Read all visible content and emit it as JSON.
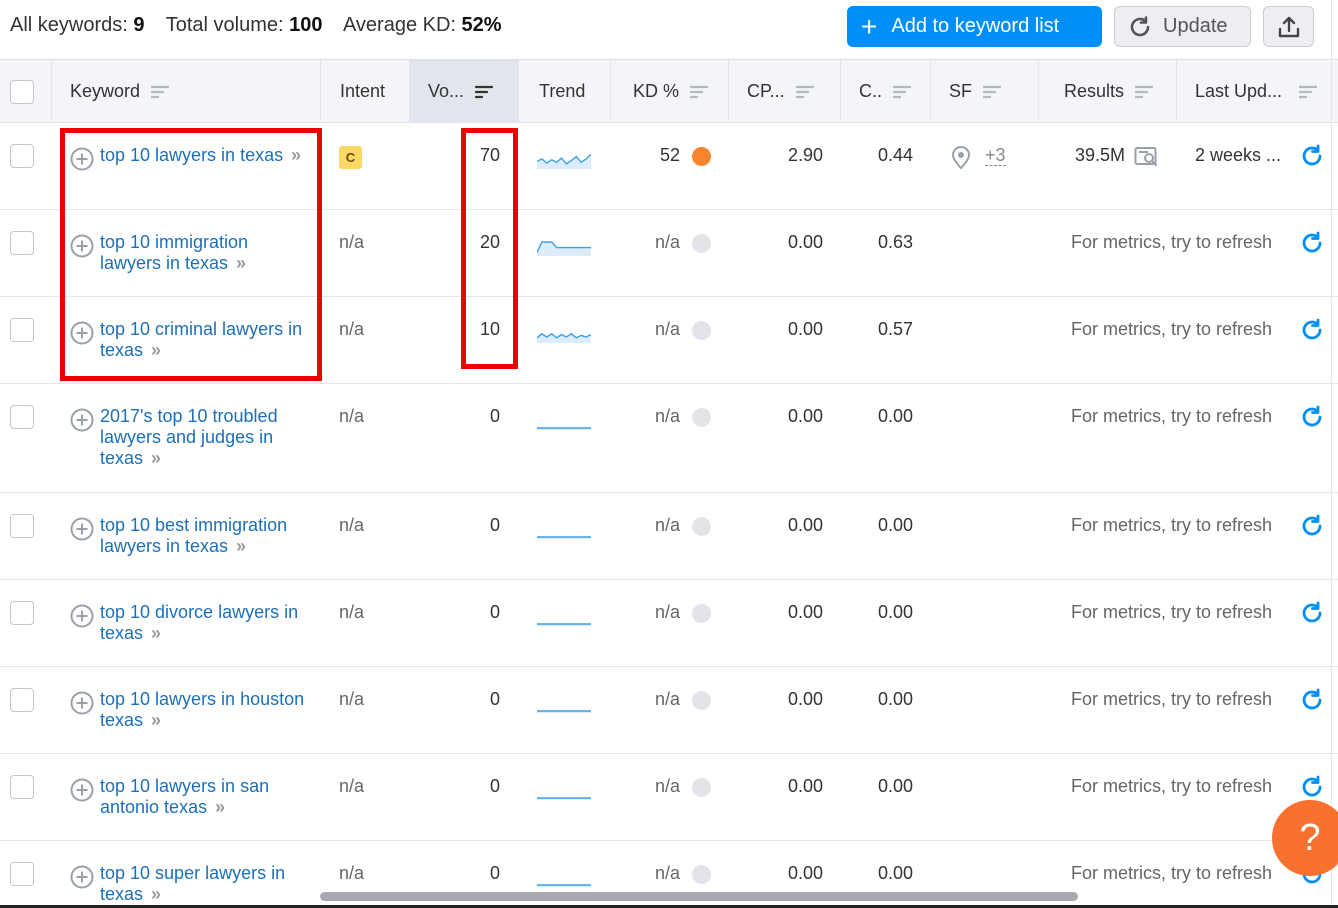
{
  "summary": {
    "all_keywords_label": "All keywords:",
    "all_keywords_value": "9",
    "total_volume_label": "Total volume:",
    "total_volume_value": "100",
    "avg_kd_label": "Average KD:",
    "avg_kd_value": "52%"
  },
  "toolbar": {
    "add_label": "Add to keyword list",
    "update_label": "Update"
  },
  "columns": {
    "keyword": "Keyword",
    "intent": "Intent",
    "volume": "Vo...",
    "trend": "Trend",
    "kd": "KD %",
    "cpc": "CP...",
    "com": "C..",
    "sf": "SF",
    "results": "Results",
    "last_update": "Last Upd..."
  },
  "colors": {
    "accent": "#008ff8",
    "link": "#1d6fb8",
    "kd_hard": "#f8852d",
    "kd_na": "#e2e4ea",
    "intent_commercial": "#fcd966",
    "highlight": "#ee0000",
    "help": "#f8712f"
  },
  "rows": [
    {
      "keyword": "top 10 lawyers in texas",
      "intent": "C",
      "volume": "70",
      "kd": "52",
      "cpc": "2.90",
      "com": "0.44",
      "sf_more": "+3",
      "results": "39.5M",
      "last_update": "2 weeks ...",
      "trend": [
        0.35,
        0.5,
        0.25,
        0.45,
        0.3,
        0.55,
        0.2,
        0.4,
        0.65,
        0.3,
        0.5,
        0.8
      ]
    },
    {
      "keyword": "top 10 immigration lawyers in texas",
      "intent": "n/a",
      "volume": "20",
      "kd": "n/a",
      "cpc": "0.00",
      "com": "0.63",
      "refresh_msg": "For metrics, try to refresh",
      "trend": [
        0.1,
        0.75,
        0.75,
        0.75,
        0.4,
        0.4,
        0.4,
        0.4,
        0.4,
        0.4,
        0.4,
        0.4
      ]
    },
    {
      "keyword": "top 10 criminal lawyers in texas",
      "intent": "n/a",
      "volume": "10",
      "kd": "n/a",
      "cpc": "0.00",
      "com": "0.57",
      "refresh_msg": "For metrics, try to refresh",
      "trend": [
        0.2,
        0.45,
        0.25,
        0.45,
        0.2,
        0.4,
        0.25,
        0.45,
        0.2,
        0.35,
        0.25,
        0.4
      ]
    },
    {
      "keyword": "2017's top 10 troubled lawyers and judges in texas",
      "intent": "n/a",
      "volume": "0",
      "kd": "n/a",
      "cpc": "0.00",
      "com": "0.00",
      "refresh_msg": "For metrics, try to refresh",
      "trend": [
        0,
        0,
        0,
        0,
        0,
        0,
        0,
        0,
        0,
        0,
        0,
        0
      ]
    },
    {
      "keyword": "top 10 best immigration lawyers in texas",
      "intent": "n/a",
      "volume": "0",
      "kd": "n/a",
      "cpc": "0.00",
      "com": "0.00",
      "refresh_msg": "For metrics, try to refresh",
      "trend": [
        0,
        0,
        0,
        0,
        0,
        0,
        0,
        0,
        0,
        0,
        0,
        0
      ]
    },
    {
      "keyword": "top 10 divorce lawyers in texas",
      "intent": "n/a",
      "volume": "0",
      "kd": "n/a",
      "cpc": "0.00",
      "com": "0.00",
      "refresh_msg": "For metrics, try to refresh",
      "trend": [
        0,
        0,
        0,
        0,
        0,
        0,
        0,
        0,
        0,
        0,
        0,
        0
      ]
    },
    {
      "keyword": "top 10 lawyers in houston texas",
      "intent": "n/a",
      "volume": "0",
      "kd": "n/a",
      "cpc": "0.00",
      "com": "0.00",
      "refresh_msg": "For metrics, try to refresh",
      "trend": [
        0,
        0,
        0,
        0,
        0,
        0,
        0,
        0,
        0,
        0,
        0,
        0
      ]
    },
    {
      "keyword": "top 10 lawyers in san antonio texas",
      "intent": "n/a",
      "volume": "0",
      "kd": "n/a",
      "cpc": "0.00",
      "com": "0.00",
      "refresh_msg": "For metrics, try to refresh",
      "trend": [
        0,
        0,
        0,
        0,
        0,
        0,
        0,
        0,
        0,
        0,
        0,
        0
      ]
    },
    {
      "keyword": "top 10 super lawyers in texas",
      "intent": "n/a",
      "volume": "0",
      "kd": "n/a",
      "cpc": "0.00",
      "com": "0.00",
      "refresh_msg": "For metrics, try to refresh",
      "trend": [
        0,
        0,
        0,
        0,
        0,
        0,
        0,
        0,
        0,
        0,
        0,
        0
      ]
    }
  ],
  "help_label": "?"
}
